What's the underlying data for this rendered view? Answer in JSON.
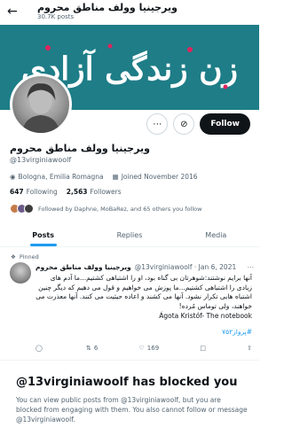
{
  "header": {
    "back_icon": "arrow-left-icon",
    "title": "ویرجینیا وولف مناطق محروم",
    "posts_count": "30.7K posts"
  },
  "banner": {
    "text": "زن زندگی آزادی",
    "color": "#1e7d87"
  },
  "profile": {
    "name": "ویرجینیا وولف مناطق محروم",
    "handle": "@13virginiawoolf",
    "location": "Bologna, Emilia Romagna",
    "joined": "Joined November 2016",
    "following_count": "647",
    "following_label": "Following",
    "followers_count": "2,563",
    "followers_label": "Followers",
    "followed_by": "Followed by Daphne, MoBaRez, and 65 others you follow"
  },
  "actions": {
    "more_icon": "more-icon",
    "grok_icon": "grok-icon",
    "follow_label": "Follow"
  },
  "tabs": [
    {
      "label": "Posts",
      "active": true
    },
    {
      "label": "Replies",
      "active": false
    },
    {
      "label": "Media",
      "active": false
    }
  ],
  "tweet": {
    "pinned_label": "Pinned",
    "author_name": "ویرجینیا وولف مناطق محروم",
    "handle_date": "@13virginiawoolf · Jan 6, 2021",
    "body": "آنها برایم نوشتند:شوهرتان بی گناه بود، او را اشتباهی کشتیم...ما آدم های زیادی را اشتباهی کشتیم...ما پوزش می خواهیم و قول می دهیم که دیگر چنین اشتباه هایی تکرار نشود. آنها می کشند و اعاده حیثیت می کنند. آنها معذرت می خواهند، ولی توماس مُرده!",
    "signature": "Ágota Kristóf- The notebook",
    "hashtag": "#پرواز۷۵۲",
    "reply_count": "",
    "retweet_count": "6",
    "like_count": "169"
  },
  "blocked": {
    "title": "@13virginiawoolf has blocked you",
    "message": "You can view public posts from @13virginiawoolf, but you are blocked from engaging with them. You also cannot follow or message @13virginiawoolf."
  }
}
